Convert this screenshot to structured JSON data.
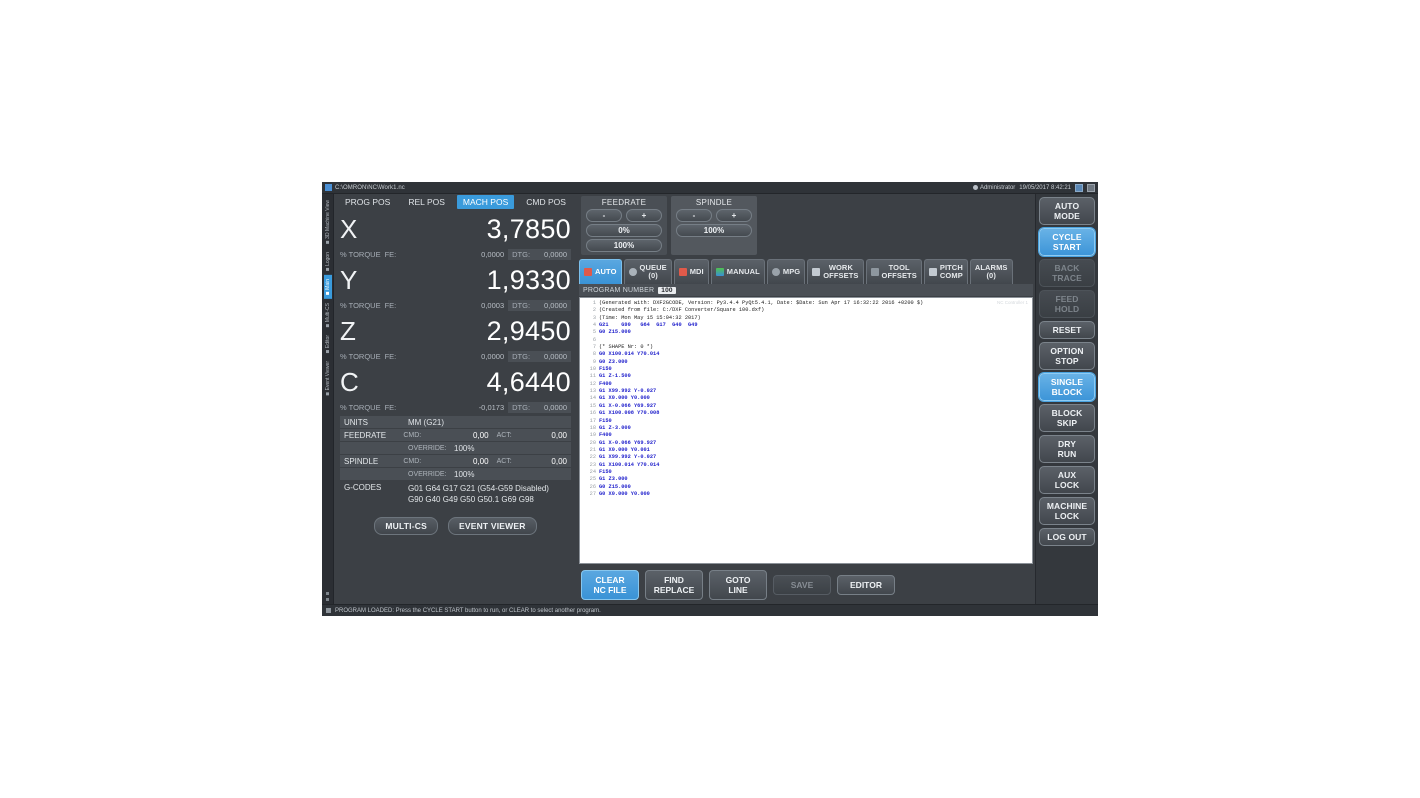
{
  "titlebar": {
    "path": "C:\\OMRON\\NC\\Work1.nc",
    "user": "Administrator",
    "datetime": "19/05/2017 8:42:21"
  },
  "vertical_tabs": [
    {
      "label": "3D Machine View",
      "selected": false
    },
    {
      "label": "Logon",
      "selected": false
    },
    {
      "label": "Main",
      "selected": true
    },
    {
      "label": "Multi-CS",
      "selected": false
    },
    {
      "label": "Editor",
      "selected": false
    },
    {
      "label": "Event Viewer",
      "selected": false
    }
  ],
  "position": {
    "tabs": [
      {
        "label": "PROG POS",
        "selected": false
      },
      {
        "label": "REL POS",
        "selected": false
      },
      {
        "label": "MACH POS",
        "selected": true
      },
      {
        "label": "CMD POS",
        "selected": false
      }
    ],
    "axes": [
      {
        "name": "X",
        "value": "3,7850",
        "torque_label": "% TORQUE",
        "fe_label": "FE:",
        "fe_value": "0,0000",
        "dtg_label": "DTG:",
        "dtg_value": "0,0000"
      },
      {
        "name": "Y",
        "value": "1,9330",
        "torque_label": "% TORQUE",
        "fe_label": "FE:",
        "fe_value": "0,0003",
        "dtg_label": "DTG:",
        "dtg_value": "0,0000"
      },
      {
        "name": "Z",
        "value": "2,9450",
        "torque_label": "% TORQUE",
        "fe_label": "FE:",
        "fe_value": "0,0000",
        "dtg_label": "DTG:",
        "dtg_value": "0,0000"
      },
      {
        "name": "C",
        "value": "4,6440",
        "torque_label": "% TORQUE",
        "fe_label": "FE:",
        "fe_value": "-0,0173",
        "dtg_label": "DTG:",
        "dtg_value": "0,0000"
      }
    ],
    "info": {
      "units_label": "UNITS",
      "units_value": "MM (G21)",
      "feedrate_label": "FEEDRATE",
      "feedrate_cmd_label": "CMD:",
      "feedrate_cmd_value": "0,00",
      "feedrate_act_label": "ACT:",
      "feedrate_act_value": "0,00",
      "feedrate_override_label": "OVERRIDE:",
      "feedrate_override_value": "100%",
      "spindle_label": "SPINDLE",
      "spindle_cmd_label": "CMD:",
      "spindle_cmd_value": "0,00",
      "spindle_act_label": "ACT:",
      "spindle_act_value": "0,00",
      "spindle_override_label": "OVERRIDE:",
      "spindle_override_value": "100%",
      "gcodes_label": "G-CODES",
      "gcodes_line1": "G01 G64 G17 G21 (G54-G59 Disabled)",
      "gcodes_line2": "G90 G40 G49 G50 G50.1 G69 G98"
    },
    "buttons": [
      {
        "label": "MULTI-CS"
      },
      {
        "label": "EVENT VIEWER"
      }
    ]
  },
  "feedrate_panel": {
    "title": "FEEDRATE",
    "minus": "-",
    "plus": "+",
    "value1": "0%",
    "value2": "100%"
  },
  "spindle_panel": {
    "title": "SPINDLE",
    "minus": "-",
    "plus": "+",
    "value1": "100%"
  },
  "mode_tabs": [
    {
      "label": "AUTO",
      "label2": "",
      "icon": "auto-icon",
      "selected": true
    },
    {
      "label": "QUEUE",
      "label2": "(0)",
      "icon": "queue-icon",
      "selected": false
    },
    {
      "label": "MDI",
      "label2": "",
      "icon": "mdi-icon",
      "selected": false
    },
    {
      "label": "MANUAL",
      "label2": "",
      "icon": "manual-icon",
      "selected": false
    },
    {
      "label": "MPG",
      "label2": "",
      "icon": "mpg-icon",
      "selected": false
    },
    {
      "label": "WORK",
      "label2": "OFFSETS",
      "icon": "work-offsets-icon",
      "selected": false
    },
    {
      "label": "TOOL",
      "label2": "OFFSETS",
      "icon": "tool-offsets-icon",
      "selected": false
    },
    {
      "label": "PITCH",
      "label2": "COMP",
      "icon": "pitch-comp-icon",
      "selected": false
    },
    {
      "label": "ALARMS",
      "label2": "(0)",
      "icon": "",
      "selected": false
    }
  ],
  "program": {
    "number_label": "PROGRAM NUMBER",
    "number_value": "100",
    "watermark": "NC Controller 1"
  },
  "gcode_lines": [
    {
      "n": "1",
      "text": "(Generated with: DXF2GCODE, Version: Py3.4.4 PyQt5.4.1, Date: $Date: Sun Apr 17 16:32:22 2016 +0200 $)",
      "type": "cmt"
    },
    {
      "n": "2",
      "text": "(Created from file: C:/DXF Converter/Square 100.dxf)",
      "type": "cmt"
    },
    {
      "n": "3",
      "text": "(Time: Mon May 15 15:04:32 2017)",
      "type": "cmt"
    },
    {
      "n": "4",
      "text": "G21    G90   G64  G17  G40  G49",
      "type": "g"
    },
    {
      "n": "5",
      "text": "G0 Z15.000",
      "type": "g"
    },
    {
      "n": "6",
      "text": "",
      "type": "cmt"
    },
    {
      "n": "7",
      "text": "(* SHAPE Nr: 0 *)",
      "type": "cmt"
    },
    {
      "n": "8",
      "text": "G0 X100.014 Y70.014",
      "type": "g"
    },
    {
      "n": "9",
      "text": "G0 Z3.000",
      "type": "g"
    },
    {
      "n": "10",
      "text": "F150",
      "type": "g"
    },
    {
      "n": "11",
      "text": "G1 Z-1.500",
      "type": "g"
    },
    {
      "n": "12",
      "text": "F400",
      "type": "g"
    },
    {
      "n": "13",
      "text": "G1 X99.992 Y-0.027",
      "type": "g"
    },
    {
      "n": "14",
      "text": "G1 X0.000 Y0.000",
      "type": "g"
    },
    {
      "n": "15",
      "text": "G1 X-0.066 Y69.927",
      "type": "g"
    },
    {
      "n": "16",
      "text": "G1 X100.008 Y70.008",
      "type": "g"
    },
    {
      "n": "17",
      "text": "F150",
      "type": "g"
    },
    {
      "n": "18",
      "text": "G1 Z-3.000",
      "type": "g"
    },
    {
      "n": "19",
      "text": "F400",
      "type": "g"
    },
    {
      "n": "20",
      "text": "G1 X-0.066 Y69.927",
      "type": "g"
    },
    {
      "n": "21",
      "text": "G1 X0.000 Y0.001",
      "type": "g"
    },
    {
      "n": "22",
      "text": "G1 X99.992 Y-0.027",
      "type": "g"
    },
    {
      "n": "23",
      "text": "G1 X100.014 Y70.014",
      "type": "g"
    },
    {
      "n": "24",
      "text": "F150",
      "type": "g"
    },
    {
      "n": "25",
      "text": "G1 Z3.000",
      "type": "g"
    },
    {
      "n": "26",
      "text": "G0 Z15.000",
      "type": "g"
    },
    {
      "n": "27",
      "text": "G0 X0.000 Y0.000",
      "type": "g"
    }
  ],
  "bottom_buttons": [
    {
      "label": "CLEAR",
      "label2": "NC FILE",
      "state": "selected"
    },
    {
      "label": "FIND",
      "label2": "REPLACE",
      "state": "normal"
    },
    {
      "label": "GOTO",
      "label2": "LINE",
      "state": "normal"
    },
    {
      "label": "SAVE",
      "label2": "",
      "state": "disabled"
    },
    {
      "label": "EDITOR",
      "label2": "",
      "state": "normal"
    }
  ],
  "right_buttons": [
    {
      "label": "AUTO",
      "label2": "MODE",
      "state": "normal"
    },
    {
      "label": "CYCLE",
      "label2": "START",
      "state": "selected"
    },
    {
      "label": "BACK",
      "label2": "TRACE",
      "state": "disabled"
    },
    {
      "label": "FEED",
      "label2": "HOLD",
      "state": "disabled"
    },
    {
      "label": "RESET",
      "label2": "",
      "state": "normal"
    },
    {
      "label": "OPTION",
      "label2": "STOP",
      "state": "normal"
    },
    {
      "label": "SINGLE",
      "label2": "BLOCK",
      "state": "selected"
    },
    {
      "label": "BLOCK",
      "label2": "SKIP",
      "state": "normal"
    },
    {
      "label": "DRY",
      "label2": "RUN",
      "state": "normal"
    },
    {
      "label": "AUX",
      "label2": "LOCK",
      "state": "normal"
    },
    {
      "label": "MACHINE",
      "label2": "LOCK",
      "state": "normal"
    },
    {
      "label": "LOG OUT",
      "label2": "",
      "state": "normal"
    }
  ],
  "statusbar": {
    "message": "PROGRAM LOADED:  Press the CYCLE START button to run, or CLEAR to select another program."
  },
  "colors": {
    "accent": "#3a9bdc",
    "panel": "#3c4045",
    "dark": "#2f3338",
    "field": "#4a4f55",
    "gcode_blue": "#2222cc"
  }
}
